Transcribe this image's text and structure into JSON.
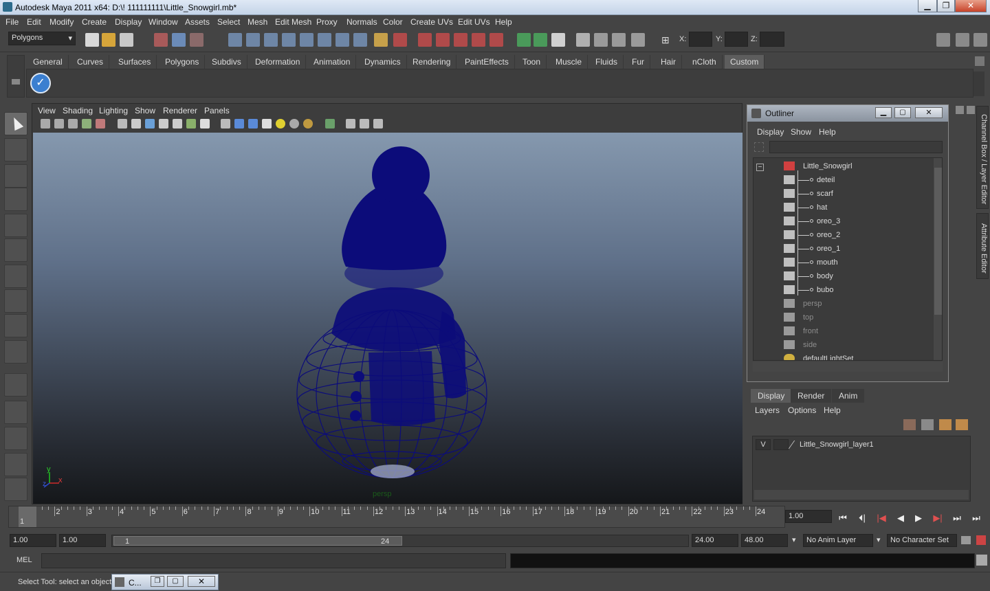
{
  "window": {
    "title": "Autodesk Maya 2011 x64: D:\\! 111111111\\Little_Snowgirl.mb*",
    "minimize": "▁",
    "maximize": "❐",
    "close": "✕"
  },
  "menubar": [
    "File",
    "Edit",
    "Modify",
    "Create",
    "Display",
    "Window",
    "Assets",
    "Select",
    "Mesh",
    "Edit Mesh",
    "Proxy",
    "Normals",
    "Color",
    "Create UVs",
    "Edit UVs",
    "Help"
  ],
  "statusline": {
    "menuset": "Polygons",
    "x_label": "X:",
    "y_label": "Y:",
    "z_label": "Z:"
  },
  "shelf": {
    "tabs": [
      "General",
      "Curves",
      "Surfaces",
      "Polygons",
      "Subdivs",
      "Deformation",
      "Animation",
      "Dynamics",
      "Rendering",
      "PaintEffects",
      "Toon",
      "Muscle",
      "Fluids",
      "Fur",
      "Hair",
      "nCloth",
      "Custom"
    ],
    "active_tab": "Custom"
  },
  "viewport": {
    "menu": [
      "View",
      "Shading",
      "Lighting",
      "Show",
      "Renderer",
      "Panels"
    ],
    "camera_label": "persp",
    "axis_y": "y",
    "axis_x": "x",
    "axis_z": "z",
    "wire_color": "#0c0c7a"
  },
  "outliner": {
    "title": "Outliner",
    "menu": [
      "Display",
      "Show",
      "Help"
    ],
    "root": "Little_Snowgirl",
    "children": [
      "deteil",
      "scarf",
      "hat",
      "oreo_3",
      "oreo_2",
      "oreo_1",
      "mouth",
      "body",
      "bubo"
    ],
    "cameras": [
      "persp",
      "top",
      "front",
      "side"
    ],
    "light_set": "defaultLightSet",
    "collapse_glyph": "−"
  },
  "side_tabs": {
    "channel_box": "Channel Box / Layer Editor",
    "attribute_editor": "Attribute Editor"
  },
  "layer_editor": {
    "tabs": [
      "Display",
      "Render",
      "Anim"
    ],
    "active_tab": "Display",
    "menu": [
      "Layers",
      "Options",
      "Help"
    ],
    "layer": {
      "visible": "V",
      "name": "Little_Snowgirl_layer1"
    }
  },
  "timeline": {
    "ticks": [
      "1",
      "2",
      "3",
      "4",
      "5",
      "6",
      "7",
      "8",
      "9",
      "10",
      "11",
      "12",
      "13",
      "14",
      "15",
      "16",
      "17",
      "18",
      "19",
      "20",
      "21",
      "22",
      "23",
      "24"
    ],
    "current_marker": "1",
    "current_time": "1.00"
  },
  "playback": [
    "⏮",
    "⏴|",
    "|◀",
    "◀",
    "▶",
    "▶|",
    "⏭",
    "⏭"
  ],
  "range": {
    "start": "1.00",
    "start_inner": "1.00",
    "slider_left": "1",
    "slider_right": "24",
    "end_inner": "24.00",
    "end": "48.00",
    "anim_layer": "No Anim Layer",
    "char_set": "No Character Set"
  },
  "command_line": {
    "label": "MEL"
  },
  "help_line": {
    "text": "Select Tool: select an object"
  },
  "taskbar": {
    "mini_label": "C..."
  }
}
